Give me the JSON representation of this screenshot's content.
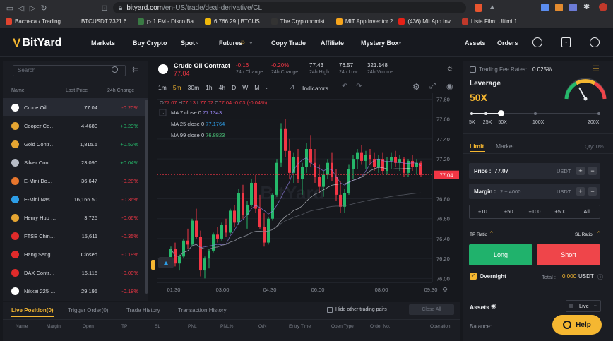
{
  "browser": {
    "url_host": "bityard.com",
    "url_path": "/en-US/trade/deal-derivative/CL",
    "bookmarks": [
      {
        "label": "Bacheca ‹ Trading…",
        "color": "#e2442f"
      },
      {
        "label": "BTCUSDT 7321.6…",
        "color": "#2b2c30"
      },
      {
        "label": "▷ 1.FM - Disco Ba…",
        "color": "#3a7a44"
      },
      {
        "label": "6,766.29 | BTCUS…",
        "color": "#f0b90b"
      },
      {
        "label": "The Cryptonomist…",
        "color": "#333"
      },
      {
        "label": "MIT App Inventor 2",
        "color": "#f7a51c"
      },
      {
        "label": "(436) Mit App Inv…",
        "color": "#e62117"
      },
      {
        "label": "Lista Film: Ultimi 1…",
        "color": "#c0392b"
      }
    ]
  },
  "nav": {
    "logo": "BitYard",
    "items": [
      "Markets",
      "Buy Crypto",
      "Spot",
      "Futures",
      "Copy Trade",
      "Affiliate",
      "Mystery Box"
    ],
    "assets": "Assets",
    "orders": "Orders"
  },
  "sidebar": {
    "search_placeholder": "Search",
    "col_name": "Name",
    "col_price": "Last Price",
    "col_change": "24h Change",
    "markets": [
      {
        "name": "Crude Oil …",
        "price": "77.04",
        "change": "-0.20%",
        "dir": "down",
        "color": "#ffffff"
      },
      {
        "name": "Cooper Co…",
        "price": "4.4680",
        "change": "+0.29%",
        "dir": "up",
        "color": "#e5a532"
      },
      {
        "name": "Gold Contr…",
        "price": "1,815.5",
        "change": "+0.52%",
        "dir": "up",
        "color": "#e5a532"
      },
      {
        "name": "Silver Cont…",
        "price": "23.090",
        "change": "+0.04%",
        "dir": "up",
        "color": "#b7bcc6"
      },
      {
        "name": "E-Mini Do…",
        "price": "36,647",
        "change": "-0.28%",
        "dir": "down",
        "color": "#e8762d"
      },
      {
        "name": "E-Mini Nas…",
        "price": "16,166.50",
        "change": "-0.36%",
        "dir": "down",
        "color": "#2d9ee8"
      },
      {
        "name": "Henry Hub …",
        "price": "3.725",
        "change": "-0.66%",
        "dir": "down",
        "color": "#e5a532"
      },
      {
        "name": "FTSE Chin…",
        "price": "15,611",
        "change": "-0.35%",
        "dir": "down",
        "color": "#e02b2b"
      },
      {
        "name": "Hang Seng…",
        "price": "Closed",
        "change": "-0.19%",
        "dir": "down",
        "color": "#e02b2b"
      },
      {
        "name": "DAX Contr…",
        "price": "16,115",
        "change": "-0.00%",
        "dir": "down",
        "color": "#e02b2b"
      },
      {
        "name": "Nikkei 225 …",
        "price": "29,195",
        "change": "-0.18%",
        "dir": "down",
        "color": "#ffffff"
      }
    ]
  },
  "ticker": {
    "name": "Crude Oil Contract",
    "price": "77.04",
    "change_abs": "-0.16",
    "change_abs_label": "24h Change",
    "change_pct": "-0.20%",
    "change_pct_label": "24h Change",
    "high": "77.43",
    "high_label": "24h High",
    "low": "76.57",
    "low_label": "24h Low",
    "volume": "321.148",
    "volume_label": "24h Volume"
  },
  "chart_toolbar": {
    "intervals": [
      "1m",
      "5m",
      "30m",
      "1h",
      "4h",
      "D",
      "W",
      "M"
    ],
    "active_interval": "5m",
    "indicators": "Indicators"
  },
  "chart_legend": {
    "o_label": "O",
    "o": "77.07",
    "h_label": "H",
    "h": "77.13",
    "l_label": "L",
    "l": "77.02",
    "c_label": "C",
    "c": "77.04",
    "chg": "-0.03 (-0.04%)",
    "ma7_label": "MA 7 close 0",
    "ma7": "77.1343",
    "ma25_label": "MA 25 close 0",
    "ma25": "77.1764",
    "ma99_label": "MA 99 close 0",
    "ma99": "76.8823"
  },
  "chart_data": {
    "type": "candlestick",
    "watermark": "BitYard",
    "yticks": [
      "77.80",
      "77.60",
      "77.40",
      "77.20",
      "77.00",
      "76.80",
      "76.60",
      "76.40",
      "76.20",
      "76.00"
    ],
    "ylim": [
      75.96,
      77.86
    ],
    "xticks": [
      "01:30",
      "03:00",
      "04:30",
      "06:00",
      "08:00",
      "09:30"
    ],
    "last_price": "77.04",
    "candles": [
      [
        76.2,
        76.32,
        76.18,
        76.3
      ],
      [
        76.3,
        76.36,
        76.12,
        76.15
      ],
      [
        76.15,
        76.24,
        76.08,
        76.22
      ],
      [
        76.22,
        76.4,
        76.2,
        76.38
      ],
      [
        76.38,
        76.5,
        76.3,
        76.34
      ],
      [
        76.34,
        76.6,
        76.32,
        76.58
      ],
      [
        76.58,
        76.7,
        76.4,
        76.42
      ],
      [
        76.42,
        76.48,
        76.02,
        76.08
      ],
      [
        76.08,
        76.22,
        76.0,
        76.2
      ],
      [
        76.2,
        76.3,
        76.1,
        76.28
      ],
      [
        76.28,
        76.46,
        76.26,
        76.44
      ],
      [
        76.44,
        76.52,
        76.36,
        76.4
      ],
      [
        76.4,
        76.56,
        76.38,
        76.54
      ],
      [
        76.54,
        76.6,
        76.42,
        76.46
      ],
      [
        76.46,
        76.7,
        76.44,
        76.68
      ],
      [
        76.68,
        76.74,
        76.52,
        76.56
      ],
      [
        76.56,
        76.9,
        76.54,
        76.86
      ],
      [
        76.86,
        76.94,
        76.6,
        76.64
      ],
      [
        76.64,
        76.78,
        76.5,
        76.74
      ],
      [
        76.74,
        77.0,
        76.72,
        76.96
      ],
      [
        76.96,
        77.04,
        76.66,
        76.7
      ],
      [
        76.7,
        76.84,
        76.5,
        76.52
      ],
      [
        76.52,
        76.66,
        76.32,
        76.36
      ],
      [
        76.36,
        76.62,
        76.34,
        76.6
      ],
      [
        76.6,
        76.86,
        76.58,
        76.84
      ],
      [
        76.84,
        77.2,
        76.82,
        77.16
      ],
      [
        77.16,
        77.56,
        77.12,
        77.5
      ],
      [
        77.5,
        77.6,
        77.22,
        77.28
      ],
      [
        77.28,
        77.4,
        77.0,
        77.06
      ],
      [
        77.06,
        77.26,
        76.96,
        77.22
      ],
      [
        77.22,
        77.3,
        76.96,
        77.0
      ],
      [
        77.0,
        77.16,
        76.84,
        77.12
      ],
      [
        77.12,
        77.36,
        77.06,
        77.3
      ],
      [
        77.3,
        77.44,
        77.12,
        77.16
      ],
      [
        77.16,
        77.3,
        76.96,
        77.02
      ],
      [
        77.02,
        77.14,
        76.86,
        76.92
      ],
      [
        76.92,
        77.08,
        76.82,
        77.04
      ],
      [
        77.04,
        77.2,
        77.0,
        77.16
      ],
      [
        77.16,
        77.26,
        76.98,
        77.02
      ],
      [
        77.02,
        77.1,
        76.78,
        76.84
      ],
      [
        76.84,
        76.98,
        76.66,
        76.72
      ],
      [
        76.72,
        76.9,
        76.66,
        76.86
      ],
      [
        76.86,
        77.14,
        76.84,
        77.1
      ],
      [
        77.1,
        77.24,
        77.0,
        77.2
      ],
      [
        77.2,
        77.3,
        77.1,
        77.26
      ],
      [
        77.26,
        77.34,
        77.14,
        77.18
      ],
      [
        77.18,
        77.28,
        77.1,
        77.24
      ],
      [
        77.24,
        77.3,
        77.14,
        77.2
      ],
      [
        77.2,
        77.26,
        77.08,
        77.12
      ],
      [
        77.12,
        77.24,
        77.06,
        77.2
      ],
      [
        77.2,
        77.26,
        77.04,
        77.08
      ],
      [
        77.08,
        77.22,
        77.04,
        77.18
      ],
      [
        77.18,
        77.26,
        77.1,
        77.22
      ],
      [
        77.22,
        77.28,
        77.12,
        77.16
      ],
      [
        77.16,
        77.24,
        77.08,
        77.2
      ],
      [
        77.2,
        77.22,
        77.02,
        77.06
      ],
      [
        77.06,
        77.2,
        77.02,
        77.18
      ],
      [
        77.18,
        77.24,
        77.08,
        77.12
      ],
      [
        77.12,
        77.2,
        77.04,
        77.16
      ],
      [
        77.16,
        77.18,
        77.02,
        77.04
      ]
    ]
  },
  "order_form": {
    "fee_label": "Trading Fee Rates:",
    "fee": "0.025%",
    "leverage_label": "Leverage",
    "leverage": "50X",
    "leverage_fraction": 0.23,
    "leverage_marks": [
      "5X",
      "25X",
      "50X",
      "100X",
      "200X"
    ],
    "tab_limit": "Limit",
    "tab_market": "Market",
    "qty_label": "Qty: 0%",
    "price_label": "Price :",
    "price": "77.07",
    "unit": "USDT",
    "margin_label": "Margin :",
    "margin_placeholder": "2 ~ 4000",
    "quick": [
      "+10",
      "+50",
      "+100",
      "+500",
      "All"
    ],
    "tp_label": "TP Ratio",
    "sl_label": "SL Ratio",
    "long": "Long",
    "short": "Short",
    "overnight": "Overnight",
    "total_label": "Total :",
    "total": "0.000",
    "total_unit": "USDT",
    "assets_label": "Assets",
    "account": "Live",
    "balance_label": "Balance:",
    "help": "Help",
    "long_color": "#20b26c",
    "short_color": "#ef454a",
    "accent": "#f5b731"
  },
  "bottom": {
    "tabs": [
      "Live Position(0)",
      "Trigger Order(0)",
      "Trade History",
      "Transaction History"
    ],
    "hide_other": "Hide other trading pairs",
    "close_all": "Close All",
    "headers": [
      "Name",
      "Margin",
      "Open",
      "TP",
      "SL",
      "PNL",
      "PNL%",
      "O/N",
      "Entry Time",
      "Open Type",
      "Order No.",
      "Operation"
    ]
  }
}
